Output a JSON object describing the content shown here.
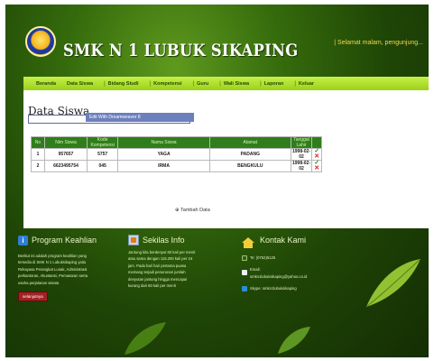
{
  "header": {
    "school_name": "SMK N 1 LUBUK SIKAPING",
    "greeting": "| Selamat malam, pengunjung..."
  },
  "nav": {
    "items": [
      "Beranda",
      "Data Siswa",
      "Bidang Studi",
      "Kompetensi",
      "Guru",
      "Wali Siswa",
      "Laporan",
      "Keluar"
    ]
  },
  "main": {
    "title": "Data Siswa",
    "editor_label": "Edit With Dreamweaver 8",
    "table": {
      "headers": [
        "No",
        "Nim Siswa",
        "Kode Kompetensi",
        "Nama Siswa",
        "Alamat",
        "Tanggal Lahir",
        ""
      ],
      "rows": [
        {
          "no": "1",
          "nim": "957657",
          "kode": "5757",
          "nama": "YAGA",
          "alamat": "PADANG",
          "tgl": "1998-02-02"
        },
        {
          "no": "2",
          "nim": "6623495754",
          "kode": "045",
          "nama": "IRMA",
          "alamat": "BENGKULU",
          "tgl": "1998-02-02"
        }
      ]
    },
    "add_label": "Tambah Data"
  },
  "footer": {
    "program": {
      "title": "Program Keahlian",
      "lines": [
        "Berikut ini adalah program keahlian yang",
        "tersedia di SMK N 1 Lubuksikaping yaitu",
        "Rekayasa Perangkat Lunak, Administrasi",
        "perkantoran, Akuntansi, Pemasaran serta",
        "usaha perjalanan wisata"
      ],
      "button": "selanjutnya"
    },
    "info": {
      "title": "Sekilas Info",
      "lines": [
        "Jantung kita berdenyut 60 kali per menit",
        "atau sama dengan 115.200 kali per 24",
        "jam. Pada hari hari pertama puasa",
        "memang terjadi penurunan jumlah",
        "denyutan jantung hingga mencapai",
        "kurang dari 60 kali per menit"
      ]
    },
    "contact": {
      "title": "Kontak Kami",
      "phone": "Te: (0752)5125",
      "email_label": "Email:",
      "email": "smkn1lubuksikaping@yahoo.co.id",
      "skype": "Skype: smkn1lubuksikaping"
    }
  },
  "colors": {
    "nav_bg": "#b4e02c",
    "table_header": "#2f7e1b",
    "button": "#a32222",
    "greeting": "#f4d84a"
  }
}
